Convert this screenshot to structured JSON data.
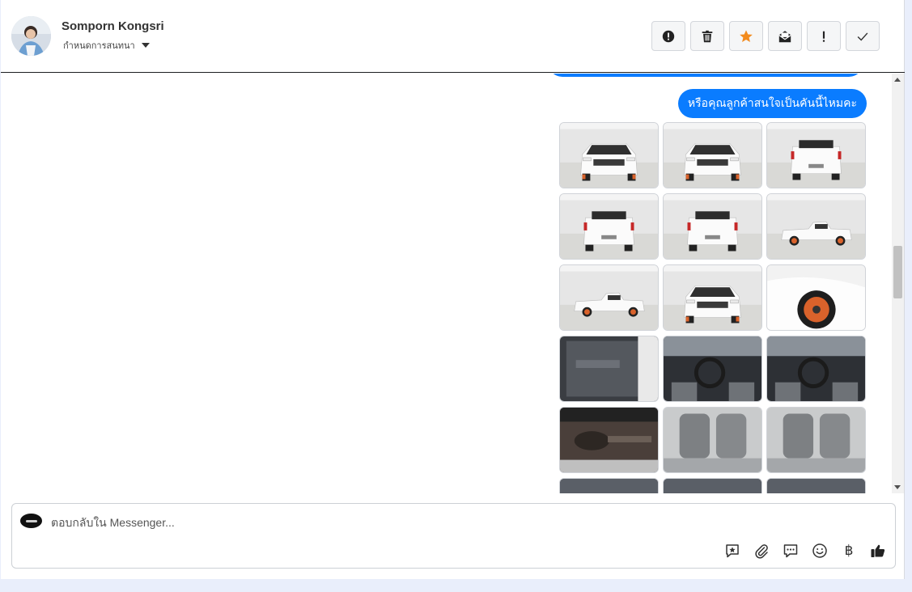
{
  "header": {
    "contact_name": "Somporn Kongsri",
    "subtitle": "กำหนดการสนทนา",
    "actions": [
      {
        "name": "report-button",
        "icon": "alert-circle-icon"
      },
      {
        "name": "delete-button",
        "icon": "trash-icon"
      },
      {
        "name": "star-button",
        "icon": "star-icon"
      },
      {
        "name": "mark-unread-button",
        "icon": "envelope-icon"
      },
      {
        "name": "important-button",
        "icon": "exclamation-icon"
      },
      {
        "name": "done-button",
        "icon": "check-icon"
      }
    ]
  },
  "conversation": {
    "message_text": "หรือคุณลูกค้าสนใจเป็นคันนี้ไหมคะ",
    "bubble_color": "#0a7cff",
    "photos": [
      {
        "scene": "truck-front"
      },
      {
        "scene": "truck-front-angle"
      },
      {
        "scene": "truck-rear-angle"
      },
      {
        "scene": "truck-rear"
      },
      {
        "scene": "truck-rear-angle-2"
      },
      {
        "scene": "truck-side"
      },
      {
        "scene": "truck-side-2"
      },
      {
        "scene": "truck-front-angle-2"
      },
      {
        "scene": "truck-wheel"
      },
      {
        "scene": "interior-door"
      },
      {
        "scene": "interior-dashboard"
      },
      {
        "scene": "interior-dashboard-2"
      },
      {
        "scene": "undercarriage"
      },
      {
        "scene": "interior-seats"
      },
      {
        "scene": "interior-seats-2"
      },
      {
        "scene": "partial"
      },
      {
        "scene": "partial"
      },
      {
        "scene": "partial"
      }
    ]
  },
  "composer": {
    "placeholder": "ตอบกลับใน Messenger...",
    "tools": [
      {
        "name": "saved-reply-button",
        "icon": "star-bubble-icon"
      },
      {
        "name": "attach-button",
        "icon": "paperclip-icon"
      },
      {
        "name": "quick-reply-button",
        "icon": "chat-bubble-icon"
      },
      {
        "name": "emoji-button",
        "icon": "smiley-icon"
      },
      {
        "name": "payment-button",
        "icon": "baht-icon",
        "glyph": "฿"
      },
      {
        "name": "like-button",
        "icon": "thumbs-up-icon"
      }
    ]
  },
  "colors": {
    "accent": "#0a7cff",
    "star": "#f28b1e",
    "wheel_orange": "#d9622b"
  }
}
